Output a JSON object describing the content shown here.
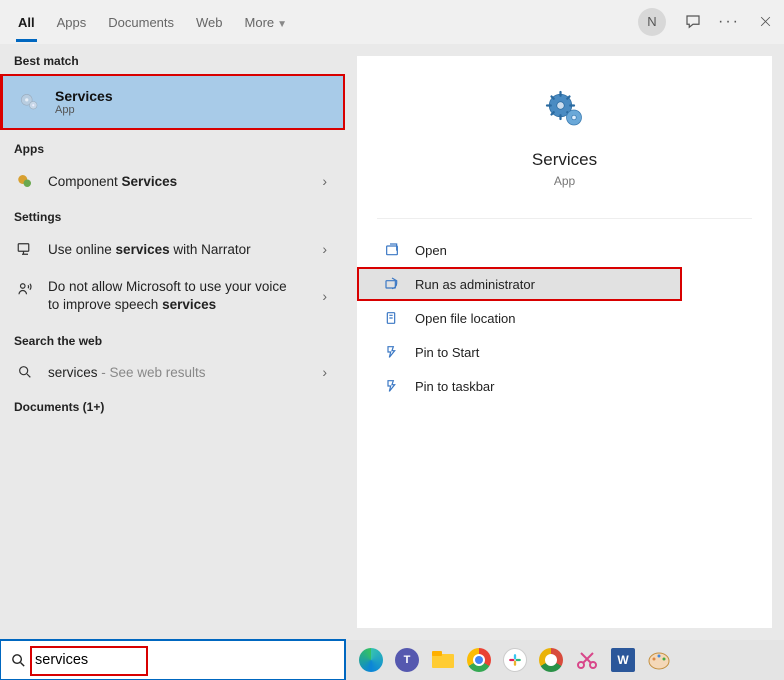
{
  "header": {
    "tabs": [
      "All",
      "Apps",
      "Documents",
      "Web",
      "More"
    ],
    "avatar_initial": "N"
  },
  "left": {
    "best_match_label": "Best match",
    "best_match": {
      "title": "Services",
      "subtitle": "App"
    },
    "apps_label": "Apps",
    "apps_item_prefix": "Component ",
    "apps_item_bold": "Services",
    "settings_label": "Settings",
    "setting1_a": "Use online ",
    "setting1_b": "services",
    "setting1_c": " with Narrator",
    "setting2_a": "Do not allow Microsoft to use your voice to improve speech ",
    "setting2_b": "services",
    "web_label": "Search the web",
    "web_item_a": "services",
    "web_item_b": " - See web results",
    "docs_label": "Documents (1+)"
  },
  "right": {
    "title": "Services",
    "subtitle": "App",
    "actions": [
      "Open",
      "Run as administrator",
      "Open file location",
      "Pin to Start",
      "Pin to taskbar"
    ]
  },
  "search": {
    "value": "services"
  }
}
